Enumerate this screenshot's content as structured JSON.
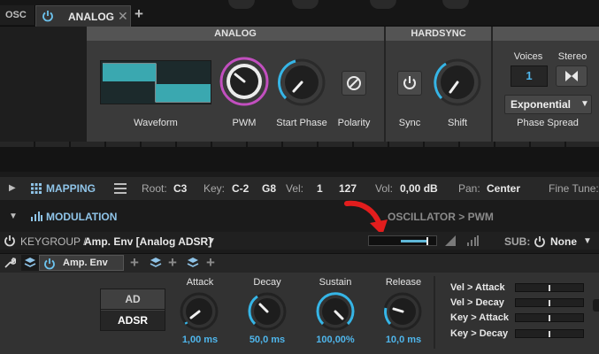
{
  "tabs": {
    "osc_label": "OSC",
    "analog_label": "ANALOG"
  },
  "sections": {
    "analog": "ANALOG",
    "hardsync": "HARDSYNC"
  },
  "analog": {
    "waveform_label": "Waveform",
    "pwm_label": "PWM",
    "start_phase_label": "Start Phase",
    "polarity_label": "Polarity"
  },
  "hardsync": {
    "sync_label": "Sync",
    "shift_label": "Shift"
  },
  "voices": {
    "voices_label": "Voices",
    "voices_value": "1",
    "stereo_label": "Stereo",
    "phase_mode": "Exponential",
    "phase_spread_label": "Phase Spread"
  },
  "mapping": {
    "label": "MAPPING",
    "root_label": "Root:",
    "root_value": "C3",
    "key_label": "Key:",
    "key_low": "C-2",
    "key_high": "G8",
    "vel_label": "Vel:",
    "vel_low": "1",
    "vel_high": "127",
    "vol_label": "Vol:",
    "vol_value": "0,00 dB",
    "pan_label": "Pan:",
    "pan_value": "Center",
    "fine_tune_label": "Fine Tune:"
  },
  "modulation": {
    "label": "MODULATION",
    "target": "OSCILLATOR > PWM"
  },
  "keygroup": {
    "prefix": "KEYGROUP /",
    "name": "Amp. Env [Analog ADSR]",
    "sub_label": "SUB:",
    "sub_value": "None",
    "mod_amount": 0.85
  },
  "env_tab": {
    "label": "Amp. Env"
  },
  "envelope": {
    "mode_ad": "AD",
    "mode_adsr": "ADSR",
    "knobs": [
      {
        "label": "Attack",
        "value": "1,00 ms"
      },
      {
        "label": "Decay",
        "value": "50,0 ms"
      },
      {
        "label": "Sustain",
        "value": "100,00%"
      },
      {
        "label": "Release",
        "value": "10,0 ms"
      }
    ],
    "mods": [
      {
        "label": "Vel > Attack",
        "amount": 0.5
      },
      {
        "label": "Vel > Decay",
        "amount": 0.5
      },
      {
        "label": "Key > Attack",
        "amount": 0.5
      },
      {
        "label": "Key > Decay",
        "amount": 0.5
      }
    ]
  },
  "colors": {
    "accent": "#36b5e6",
    "pwm_ring": "#c24fbf",
    "wave_fill": "#3aa8b0",
    "arrow": "#e21d1d"
  }
}
